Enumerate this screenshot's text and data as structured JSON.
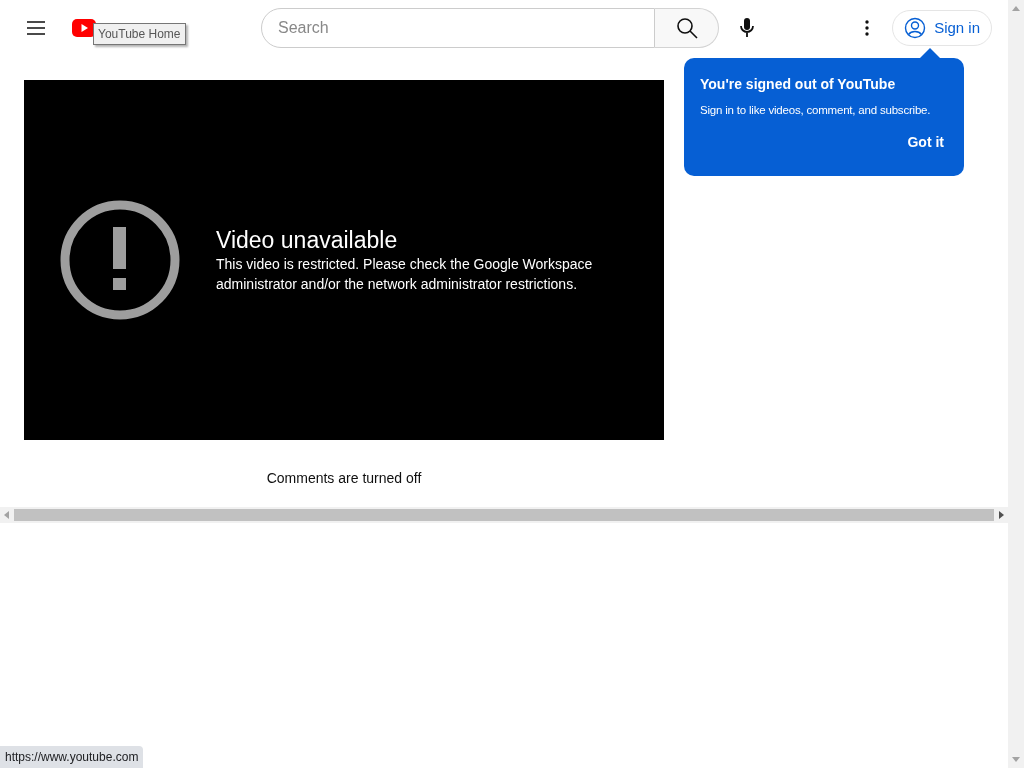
{
  "header": {
    "search": {
      "placeholder": "Search"
    },
    "sign_in": "Sign in"
  },
  "tooltip": "YouTube Home",
  "player": {
    "title": "Video unavailable",
    "message": "This video is restricted. Please check the Google Workspace administrator and/or the network administrator restrictions."
  },
  "comments_note": "Comments are turned off",
  "popup": {
    "title": "You're signed out of YouTube",
    "body": "Sign in to like videos, comment, and subscribe.",
    "button": "Got it"
  },
  "status_bar": {
    "url": "https://www.youtube.com"
  }
}
